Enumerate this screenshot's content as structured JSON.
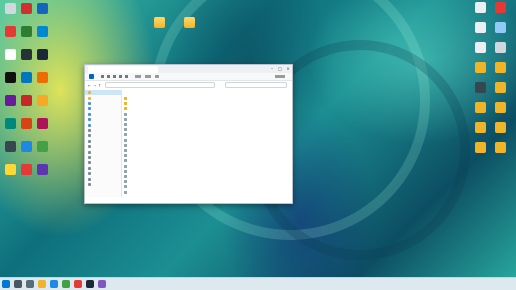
{
  "colors": {
    "accent": "#0067c0",
    "folder": "#f0b429"
  },
  "desktop": {
    "icons_left": [
      {
        "name": "recycle-bin-icon",
        "color": "#cfd8dc",
        "label": ""
      },
      {
        "name": "app-icon",
        "color": "#d32f2f",
        "label": ""
      },
      {
        "name": "app-icon",
        "color": "#1565c0",
        "label": ""
      },
      {
        "name": "app-icon",
        "color": "#e53935",
        "label": ""
      },
      {
        "name": "app-icon",
        "color": "#2e7d32",
        "label": ""
      },
      {
        "name": "app-icon",
        "color": "#0288d1",
        "label": ""
      },
      {
        "name": "app-icon",
        "color": "#ffffff",
        "label": ""
      },
      {
        "name": "app-icon",
        "color": "#263238",
        "label": ""
      },
      {
        "name": "steam-icon",
        "color": "#1b2838",
        "label": ""
      },
      {
        "name": "app-icon",
        "color": "#111111",
        "label": ""
      },
      {
        "name": "app-icon",
        "color": "#0277bd",
        "label": ""
      },
      {
        "name": "app-icon",
        "color": "#ef6c00",
        "label": ""
      },
      {
        "name": "app-icon",
        "color": "#6a1b9a",
        "label": ""
      },
      {
        "name": "app-icon",
        "color": "#c62828",
        "label": ""
      },
      {
        "name": "app-icon",
        "color": "#f9a825",
        "label": ""
      },
      {
        "name": "app-icon",
        "color": "#00897b",
        "label": ""
      },
      {
        "name": "app-icon",
        "color": "#d84315",
        "label": ""
      },
      {
        "name": "app-icon",
        "color": "#ad1457",
        "label": ""
      },
      {
        "name": "app-icon",
        "color": "#37474f",
        "label": ""
      },
      {
        "name": "app-icon",
        "color": "#1e88e5",
        "label": ""
      },
      {
        "name": "app-icon",
        "color": "#43a047",
        "label": ""
      },
      {
        "name": "app-icon",
        "color": "#fdd835",
        "label": ""
      },
      {
        "name": "app-icon",
        "color": "#e53935",
        "label": ""
      },
      {
        "name": "app-icon",
        "color": "#5e35b1",
        "label": ""
      }
    ],
    "icons_top": [
      {
        "name": "folder-icon",
        "label": ""
      },
      {
        "name": "folder-icon",
        "label": ""
      }
    ],
    "icons_right": [
      {
        "name": "file-icon",
        "color": "#eceff1"
      },
      {
        "name": "app-icon",
        "color": "#e53935"
      },
      {
        "name": "file-icon",
        "color": "#eceff1"
      },
      {
        "name": "file-icon",
        "color": "#90caf9"
      },
      {
        "name": "file-icon",
        "color": "#eceff1"
      },
      {
        "name": "file-icon",
        "color": "#cfd8dc"
      },
      {
        "name": "folder-icon",
        "color": "#f0b429"
      },
      {
        "name": "folder-icon",
        "color": "#f0b429"
      },
      {
        "name": "file-icon",
        "color": "#37474f"
      },
      {
        "name": "folder-icon",
        "color": "#f0b429"
      },
      {
        "name": "folder-icon",
        "color": "#f0b429"
      },
      {
        "name": "folder-icon",
        "color": "#f0b429"
      },
      {
        "name": "folder-icon",
        "color": "#f0b429"
      },
      {
        "name": "folder-icon",
        "color": "#f0b429"
      },
      {
        "name": "folder-icon",
        "color": "#f0b429"
      },
      {
        "name": "folder-icon",
        "color": "#f0b429"
      }
    ]
  },
  "explorer": {
    "tab_title": "",
    "address": "",
    "search_placeholder": "",
    "nav_items": [
      "",
      "",
      "",
      "",
      "",
      "",
      "",
      "",
      "",
      "",
      "",
      "",
      "",
      "",
      "",
      "",
      "",
      ""
    ],
    "columns": {
      "name": "",
      "date": "",
      "type": "",
      "size": ""
    },
    "files": [
      {
        "name": "",
        "date": "",
        "type": "",
        "size": "",
        "color": "#f0b429"
      },
      {
        "name": "",
        "date": "",
        "type": "",
        "size": "",
        "color": "#f0b429"
      },
      {
        "name": "",
        "date": "",
        "type": "",
        "size": "",
        "color": "#f0b429"
      },
      {
        "name": "",
        "date": "",
        "type": "",
        "size": "",
        "color": "#90a4ae"
      },
      {
        "name": "",
        "date": "",
        "type": "",
        "size": "",
        "color": "#90a4ae"
      },
      {
        "name": "",
        "date": "",
        "type": "",
        "size": "",
        "color": "#90a4ae"
      },
      {
        "name": "",
        "date": "",
        "type": "",
        "size": "",
        "color": "#90a4ae"
      },
      {
        "name": "",
        "date": "",
        "type": "",
        "size": "",
        "color": "#90a4ae"
      },
      {
        "name": "",
        "date": "",
        "type": "",
        "size": "",
        "color": "#90a4ae"
      },
      {
        "name": "",
        "date": "",
        "type": "",
        "size": "",
        "color": "#90a4ae"
      },
      {
        "name": "",
        "date": "",
        "type": "",
        "size": "",
        "color": "#90a4ae"
      },
      {
        "name": "",
        "date": "",
        "type": "",
        "size": "",
        "color": "#90a4ae"
      },
      {
        "name": "",
        "date": "",
        "type": "",
        "size": "",
        "color": "#90a4ae"
      },
      {
        "name": "",
        "date": "",
        "type": "",
        "size": "",
        "color": "#90a4ae"
      },
      {
        "name": "",
        "date": "",
        "type": "",
        "size": "",
        "color": "#90a4ae"
      },
      {
        "name": "",
        "date": "",
        "type": "",
        "size": "",
        "color": "#90a4ae"
      },
      {
        "name": "",
        "date": "",
        "type": "",
        "size": "",
        "color": "#90a4ae"
      },
      {
        "name": "",
        "date": "",
        "type": "",
        "size": "",
        "color": "#90a4ae"
      },
      {
        "name": "",
        "date": "",
        "type": "",
        "size": "",
        "color": "#90a4ae"
      }
    ],
    "status": ""
  },
  "taskbar": {
    "icons": [
      {
        "name": "start-icon",
        "color": "#0078d4"
      },
      {
        "name": "search-icon",
        "color": "#455a64"
      },
      {
        "name": "task-view-icon",
        "color": "#546e7a"
      },
      {
        "name": "file-explorer-icon",
        "color": "#f0b429"
      },
      {
        "name": "browser-icon",
        "color": "#1e88e5"
      },
      {
        "name": "browser-icon",
        "color": "#43a047"
      },
      {
        "name": "app-icon",
        "color": "#e53935"
      },
      {
        "name": "app-icon",
        "color": "#1b2838"
      },
      {
        "name": "app-icon",
        "color": "#7e57c2"
      }
    ],
    "time": "",
    "date": ""
  }
}
